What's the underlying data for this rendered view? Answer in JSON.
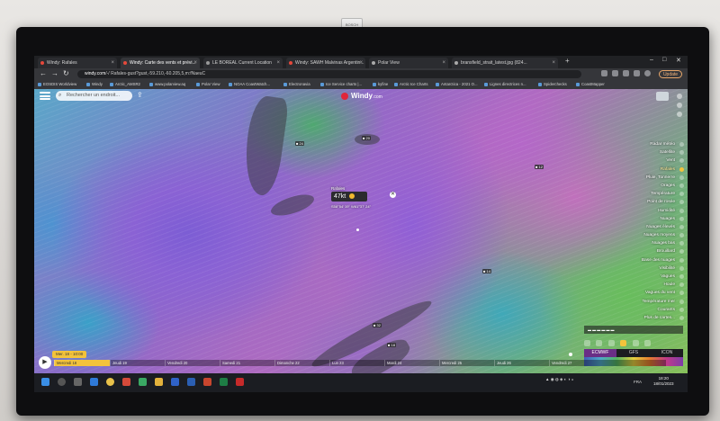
{
  "camera_label": "BOSCH",
  "browser": {
    "tabs": [
      {
        "label": "Windy: Rafales",
        "active": false
      },
      {
        "label": "Windy: Carte des vents et prévi...",
        "active": true
      },
      {
        "label": "LE BOREAL Current Location",
        "active": false
      },
      {
        "label": "Windy: SAWH Malvinas Argentin...",
        "active": false
      },
      {
        "label": "Polar View",
        "active": false
      },
      {
        "label": "bransfield_strait_latest.jpg (824...",
        "active": false
      }
    ],
    "new_tab": "+",
    "window_controls": {
      "minimize": "–",
      "maximize": "□",
      "close": "✕"
    },
    "nav": {
      "back": "←",
      "forward": "→",
      "reload": "↻"
    },
    "url_domain": "windy.com",
    "url_path": "/-/ Rafales-gust?gust,-59.210,-60.205,5,m:fNaeuC",
    "update_label": "Update",
    "bookmarks": [
      "EOSDIS Worldview",
      "Windy",
      "Arctic_AMSR2",
      "www.polarview.aq",
      "Polar View",
      "NOAA CoastWatch...",
      "Electronavia",
      "Ice Service charts |...",
      "kyfine",
      "Arctic Ice Charts",
      "Antarctica - 2021 O...",
      "Lignes directrices n...",
      "Spiderchecks",
      "CoastMapper"
    ]
  },
  "windy": {
    "search_placeholder": "Rechercher un endroit...",
    "search_icon": "search-icon",
    "logo_text": "Windy",
    "logo_suffix": ".com",
    "layers": [
      {
        "label": "Radar météo",
        "selected": false
      },
      {
        "label": "Satellite",
        "selected": false
      },
      {
        "label": "Vent",
        "selected": false
      },
      {
        "label": "Rafales",
        "selected": true
      },
      {
        "label": "Pluie, Tonnerre",
        "selected": false
      },
      {
        "label": "Orages",
        "selected": false
      },
      {
        "label": "Température",
        "selected": false
      },
      {
        "label": "Point de rosée",
        "selected": false
      },
      {
        "label": "Humidité",
        "selected": false
      },
      {
        "label": "Nuages",
        "selected": false
      },
      {
        "label": "Nuages élevés",
        "selected": false
      },
      {
        "label": "Nuages moyens",
        "selected": false
      },
      {
        "label": "Nuages bas",
        "selected": false
      },
      {
        "label": "Brouillard",
        "selected": false
      },
      {
        "label": "Base des nuages",
        "selected": false
      },
      {
        "label": "Visibilité",
        "selected": false
      },
      {
        "label": "Vagues",
        "selected": false
      },
      {
        "label": "Houle",
        "selected": false
      },
      {
        "label": "Vagues du vent",
        "selected": false
      },
      {
        "label": "Température mer",
        "selected": false
      },
      {
        "label": "Courants",
        "selected": false
      },
      {
        "label": "Plus de cartes...",
        "selected": false
      }
    ],
    "popup": {
      "place": "Rafales",
      "value": "47kt",
      "close": "✕",
      "coords": "S58°54' 19\"  W61°37' 24\""
    },
    "more_maps": "Plus de cartes",
    "models": [
      {
        "label": "ECMWF",
        "selected": true
      },
      {
        "label": "GFS",
        "selected": false
      },
      {
        "label": "ICON",
        "selected": false
      }
    ],
    "current_time": "Mer. 18 - 10:00",
    "days": [
      {
        "label": "Mercredi 18",
        "selected": true
      },
      {
        "label": "Jeudi 19",
        "selected": false
      },
      {
        "label": "Vendredi 20",
        "selected": false
      },
      {
        "label": "Samedi 21",
        "selected": false
      },
      {
        "label": "Dimanche 22",
        "selected": false
      },
      {
        "label": "Lun 23",
        "selected": false
      },
      {
        "label": "Mardi 24",
        "selected": false
      },
      {
        "label": "Mercredi 25",
        "selected": false
      },
      {
        "label": "Jeudi 26",
        "selected": false
      },
      {
        "label": "Vendredi 27",
        "selected": false
      }
    ]
  },
  "taskbar": {
    "language": "FRA",
    "time": "18:20",
    "date": "18/01/2023"
  }
}
